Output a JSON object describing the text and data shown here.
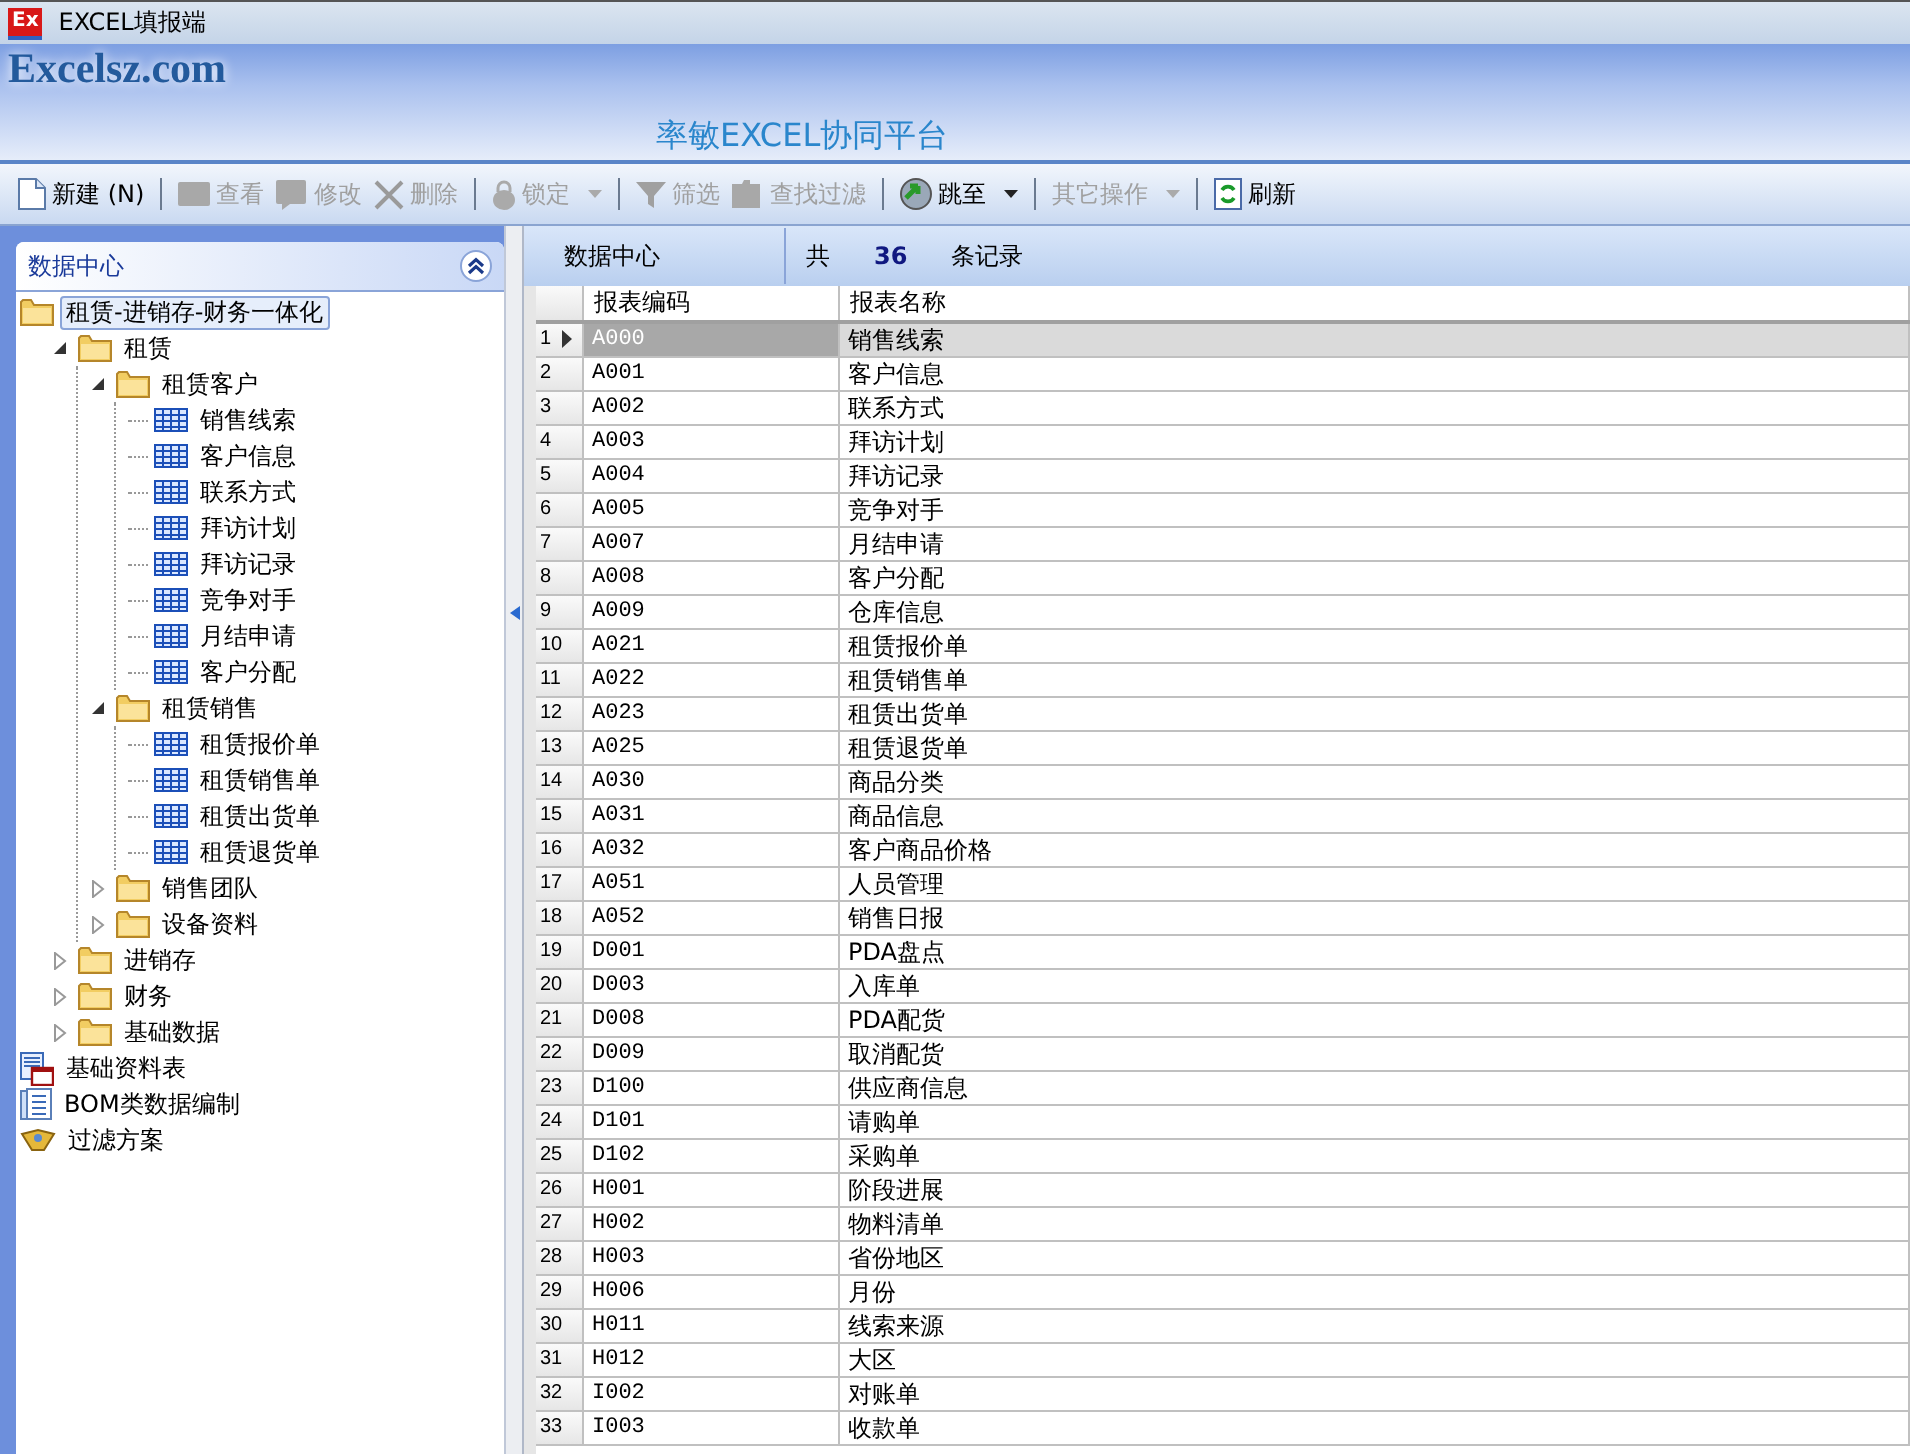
{
  "window": {
    "title": "EXCEL填报端",
    "app_icon_text": "Ex"
  },
  "banner": {
    "logo": "Excelsz.com",
    "platform_title": "率敏EXCEL协同平台"
  },
  "toolbar": [
    {
      "kind": "button",
      "label": "新建 (N)",
      "disabled": false,
      "dropdown": false
    },
    {
      "kind": "separator"
    },
    {
      "kind": "button",
      "label": "查看",
      "disabled": true,
      "dropdown": false
    },
    {
      "kind": "button",
      "label": "修改",
      "disabled": true,
      "dropdown": false
    },
    {
      "kind": "button",
      "label": "删除",
      "disabled": true,
      "dropdown": false
    },
    {
      "kind": "separator"
    },
    {
      "kind": "button",
      "label": "锁定",
      "disabled": true,
      "dropdown": true
    },
    {
      "kind": "separator"
    },
    {
      "kind": "button",
      "label": "筛选",
      "disabled": true,
      "dropdown": false
    },
    {
      "kind": "button",
      "label": "查找过滤",
      "disabled": true,
      "dropdown": false
    },
    {
      "kind": "separator"
    },
    {
      "kind": "button",
      "label": "跳至",
      "disabled": false,
      "dropdown": true
    },
    {
      "kind": "separator"
    },
    {
      "kind": "button",
      "label": "其它操作",
      "disabled": true,
      "dropdown": true
    },
    {
      "kind": "separator"
    },
    {
      "kind": "button",
      "label": "刷新",
      "disabled": false,
      "dropdown": false
    }
  ],
  "sidebar": {
    "title": "数据中心",
    "tree": [
      {
        "kind": "folder",
        "label": "租赁-进销存-财务一体化",
        "selected": true,
        "children": [
          {
            "kind": "folder",
            "label": "租赁",
            "selected": false,
            "expanded": true,
            "children": [
              {
                "kind": "folder",
                "label": "租赁客户",
                "selected": false,
                "expanded": true,
                "children": [
                  {
                    "kind": "table",
                    "label": "销售线索",
                    "selected": false
                  },
                  {
                    "kind": "table",
                    "label": "客户信息",
                    "selected": false
                  },
                  {
                    "kind": "table",
                    "label": "联系方式",
                    "selected": false
                  },
                  {
                    "kind": "table",
                    "label": "拜访计划",
                    "selected": false
                  },
                  {
                    "kind": "table",
                    "label": "拜访记录",
                    "selected": false
                  },
                  {
                    "kind": "table",
                    "label": "竞争对手",
                    "selected": false
                  },
                  {
                    "kind": "table",
                    "label": "月结申请",
                    "selected": false
                  },
                  {
                    "kind": "table",
                    "label": "客户分配",
                    "selected": false
                  }
                ]
              },
              {
                "kind": "folder",
                "label": "租赁销售",
                "selected": false,
                "expanded": true,
                "children": [
                  {
                    "kind": "table",
                    "label": "租赁报价单",
                    "selected": false
                  },
                  {
                    "kind": "table",
                    "label": "租赁销售单",
                    "selected": false
                  },
                  {
                    "kind": "table",
                    "label": "租赁出货单",
                    "selected": false
                  },
                  {
                    "kind": "table",
                    "label": "租赁退货单",
                    "selected": false
                  }
                ]
              },
              {
                "kind": "folder",
                "label": "销售团队",
                "selected": false,
                "expanded": false
              },
              {
                "kind": "folder",
                "label": "设备资料",
                "selected": false,
                "expanded": false
              }
            ]
          },
          {
            "kind": "folder",
            "label": "进销存",
            "selected": false,
            "expanded": false
          },
          {
            "kind": "folder",
            "label": "财务",
            "selected": false,
            "expanded": false
          },
          {
            "kind": "folder",
            "label": "基础数据",
            "selected": false,
            "expanded": false
          }
        ]
      },
      {
        "kind": "report",
        "label": "基础资料表",
        "selected": false
      },
      {
        "kind": "document",
        "label": "BOM类数据编制",
        "selected": false
      },
      {
        "kind": "filter",
        "label": "过滤方案",
        "selected": false
      }
    ]
  },
  "grid_header": {
    "title": "数据中心",
    "count_prefix": "共",
    "count": "36",
    "count_suffix": "条记录"
  },
  "table": {
    "columns": [
      "报表编码",
      "报表名称"
    ],
    "rows": [
      {
        "num": "1",
        "code": "A000",
        "name": "销售线索",
        "selected": true
      },
      {
        "num": "2",
        "code": "A001",
        "name": "客户信息",
        "selected": false
      },
      {
        "num": "3",
        "code": "A002",
        "name": "联系方式",
        "selected": false
      },
      {
        "num": "4",
        "code": "A003",
        "name": "拜访计划",
        "selected": false
      },
      {
        "num": "5",
        "code": "A004",
        "name": "拜访记录",
        "selected": false
      },
      {
        "num": "6",
        "code": "A005",
        "name": "竞争对手",
        "selected": false
      },
      {
        "num": "7",
        "code": "A007",
        "name": "月结申请",
        "selected": false
      },
      {
        "num": "8",
        "code": "A008",
        "name": "客户分配",
        "selected": false
      },
      {
        "num": "9",
        "code": "A009",
        "name": "仓库信息",
        "selected": false
      },
      {
        "num": "10",
        "code": "A021",
        "name": "租赁报价单",
        "selected": false
      },
      {
        "num": "11",
        "code": "A022",
        "name": "租赁销售单",
        "selected": false
      },
      {
        "num": "12",
        "code": "A023",
        "name": "租赁出货单",
        "selected": false
      },
      {
        "num": "13",
        "code": "A025",
        "name": "租赁退货单",
        "selected": false
      },
      {
        "num": "14",
        "code": "A030",
        "name": "商品分类",
        "selected": false
      },
      {
        "num": "15",
        "code": "A031",
        "name": "商品信息",
        "selected": false
      },
      {
        "num": "16",
        "code": "A032",
        "name": "客户商品价格",
        "selected": false
      },
      {
        "num": "17",
        "code": "A051",
        "name": "人员管理",
        "selected": false
      },
      {
        "num": "18",
        "code": "A052",
        "name": "销售日报",
        "selected": false
      },
      {
        "num": "19",
        "code": "D001",
        "name": "PDA盘点",
        "selected": false
      },
      {
        "num": "20",
        "code": "D003",
        "name": "入库单",
        "selected": false
      },
      {
        "num": "21",
        "code": "D008",
        "name": "PDA配货",
        "selected": false
      },
      {
        "num": "22",
        "code": "D009",
        "name": "取消配货",
        "selected": false
      },
      {
        "num": "23",
        "code": "D100",
        "name": "供应商信息",
        "selected": false
      },
      {
        "num": "24",
        "code": "D101",
        "name": "请购单",
        "selected": false
      },
      {
        "num": "25",
        "code": "D102",
        "name": "采购单",
        "selected": false
      },
      {
        "num": "26",
        "code": "H001",
        "name": "阶段进展",
        "selected": false
      },
      {
        "num": "27",
        "code": "H002",
        "name": "物料清单",
        "selected": false
      },
      {
        "num": "28",
        "code": "H003",
        "name": "省份地区",
        "selected": false
      },
      {
        "num": "29",
        "code": "H006",
        "name": "月份",
        "selected": false
      },
      {
        "num": "30",
        "code": "H011",
        "name": "线索来源",
        "selected": false
      },
      {
        "num": "31",
        "code": "H012",
        "name": "大区",
        "selected": false
      },
      {
        "num": "32",
        "code": "I002",
        "name": "对账单",
        "selected": false
      },
      {
        "num": "33",
        "code": "I003",
        "name": "收款单",
        "selected": false
      }
    ]
  }
}
